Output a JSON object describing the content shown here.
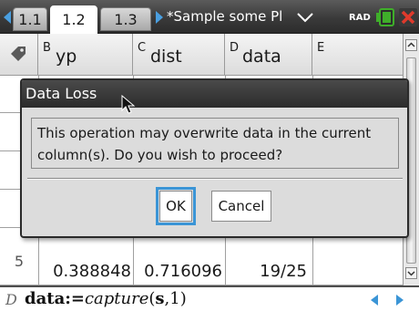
{
  "tabs": [
    {
      "label": "1.1",
      "active": false
    },
    {
      "label": "1.2",
      "active": true
    },
    {
      "label": "1.3",
      "active": false
    }
  ],
  "document_title": "*Sample some Pl",
  "mode_indicator": "RAD",
  "columns": [
    {
      "letter": "B",
      "name": "yp"
    },
    {
      "letter": "C",
      "name": "dist"
    },
    {
      "letter": "D",
      "name": "data"
    },
    {
      "letter": "E",
      "name": ""
    }
  ],
  "visible_row": {
    "index": "5",
    "cells": [
      "0.388848",
      "0.716096",
      "19/25",
      ""
    ]
  },
  "entry_line": {
    "column_tag": "D",
    "formula_name": "data:=",
    "formula_function": "capture",
    "formula_open": "(",
    "formula_arg1": "s",
    "formula_rest": ",1)"
  },
  "dialog": {
    "title": "Data Loss",
    "message": "This operation may overwrite data in the current column(s). Do you wish to proceed?",
    "ok_label": "OK",
    "cancel_label": "Cancel"
  },
  "colors": {
    "accent": "#3b95d6",
    "close": "#e03a2c",
    "battery": "#3fae2a"
  },
  "icons": [
    "tab-scroll-left-icon",
    "tab-scroll-right-icon",
    "doc-menu-chevron-icon",
    "battery-icon",
    "close-icon",
    "tag-icon",
    "scroll-up-icon",
    "scroll-down-icon",
    "nav-left-icon",
    "nav-right-icon",
    "mouse-pointer-icon"
  ]
}
